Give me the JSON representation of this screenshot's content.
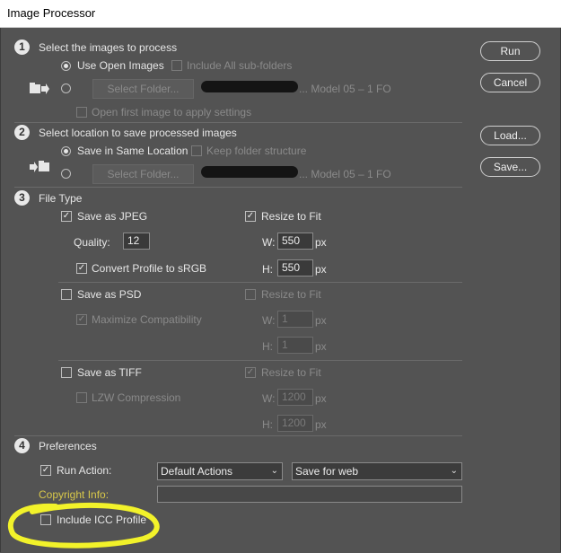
{
  "window": {
    "title": "Image Processor"
  },
  "section1": {
    "number": "1",
    "heading": "Select the images to process",
    "use_open_images": "Use Open Images",
    "include_subfolders": "Include All sub-folders",
    "select_folder": "Select Folder...",
    "path_suffix": "... Model 05 – 1 FO",
    "open_first_image": "Open first image to apply settings"
  },
  "section2": {
    "number": "2",
    "heading": "Select location to save processed images",
    "save_same_location": "Save in Same Location",
    "keep_folder_structure": "Keep folder structure",
    "select_folder": "Select Folder...",
    "path_suffix": "... Model 05 – 1 FO"
  },
  "section3": {
    "number": "3",
    "heading": "File Type",
    "jpeg": {
      "save_label": "Save as JPEG",
      "quality_label": "Quality:",
      "quality_value": "12",
      "convert_profile": "Convert Profile to sRGB",
      "resize_label": "Resize to Fit",
      "w_label": "W:",
      "w_value": "550",
      "w_unit": "px",
      "h_label": "H:",
      "h_value": "550",
      "h_unit": "px"
    },
    "psd": {
      "save_label": "Save as PSD",
      "maximize": "Maximize Compatibility",
      "resize_label": "Resize to Fit",
      "w_label": "W:",
      "w_value": "1",
      "w_unit": "px",
      "h_label": "H:",
      "h_value": "1",
      "h_unit": "px"
    },
    "tiff": {
      "save_label": "Save as TIFF",
      "lzw": "LZW Compression",
      "resize_label": "Resize to Fit",
      "w_label": "W:",
      "w_value": "1200",
      "w_unit": "px",
      "h_label": "H:",
      "h_value": "1200",
      "h_unit": "px"
    }
  },
  "section4": {
    "number": "4",
    "heading": "Preferences",
    "run_action": "Run Action:",
    "action_set": "Default Actions",
    "action": "Save for web",
    "copyright_label": "Copyright Info:",
    "copyright_value": "",
    "include_icc": "Include ICC Profile"
  },
  "buttons": {
    "run": "Run",
    "cancel": "Cancel",
    "load": "Load...",
    "save": "Save..."
  },
  "glyphs": {
    "check": "✓",
    "chevron": "⌄"
  },
  "colors": {
    "background": "#535353",
    "highlight_circle": "#f2f22a",
    "copyright_label": "#d8c84a"
  }
}
